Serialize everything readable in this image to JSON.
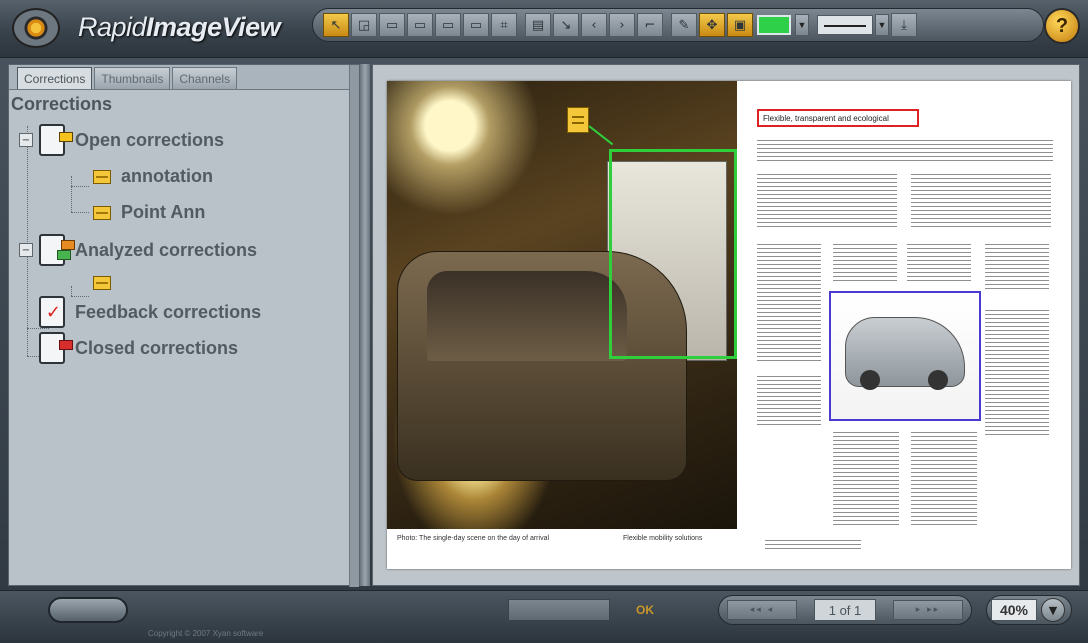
{
  "app": {
    "title_prefix": "Rapid",
    "title_main": "ImageView"
  },
  "toolbar": {
    "buttons": [
      "cursor",
      "rect-select",
      "rect-1",
      "rect-2",
      "rect-3",
      "rect-4",
      "crop",
      "ruler",
      "arrow",
      "line",
      "curve",
      "pencil",
      "pan",
      "note"
    ],
    "accent_color": "#2ed04a",
    "help_label": "?"
  },
  "left_panel": {
    "tabs": [
      "Corrections",
      "Thumbnails",
      "Channels"
    ],
    "tree_root": "Corrections",
    "nodes": {
      "open": "Open corrections",
      "annotation": "annotation",
      "point_ann": "Point Ann",
      "analyzed": "Analyzed corrections",
      "feedback": "Feedback corrections",
      "closed": "Closed corrections"
    }
  },
  "document": {
    "heading": "Flexible, transparent and ecological",
    "caption_left": "Photo: The single-day scene on the day of arrival",
    "caption_mid": "Flexible mobility solutions",
    "colors": {
      "green_annotation": "#2fcf3c",
      "red_annotation": "#dd2222",
      "blue_annotation": "#4a3bd0"
    }
  },
  "bottombar": {
    "copyright": "Copyright © 2007 Xyan software",
    "status": "OK",
    "page_indicator": "1 of 1",
    "zoom": "40%"
  }
}
